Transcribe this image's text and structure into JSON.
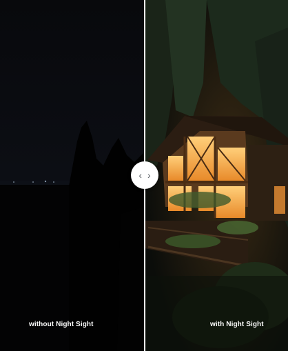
{
  "comparison": {
    "left_caption": "without Night Sight",
    "right_caption": "with Night Sight",
    "handle_icons": {
      "left": "chevron-left-icon",
      "right": "chevron-right-icon"
    },
    "handle_glyphs": {
      "left": "‹",
      "right": "›"
    },
    "divider_position_fraction": 0.5
  },
  "colors": {
    "divider": "#ffffff",
    "handle_bg": "#ffffff",
    "handle_icon": "#5f6368",
    "caption": "#ffffff"
  }
}
